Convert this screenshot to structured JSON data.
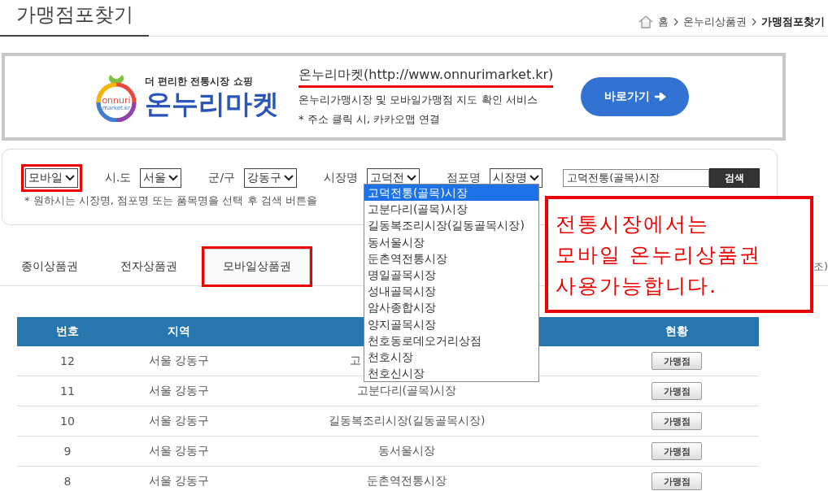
{
  "page_title": "가맹점포찾기",
  "breadcrumb": [
    {
      "label": "홈",
      "current": false
    },
    {
      "label": "온누리상품권",
      "current": false
    },
    {
      "label": "가맹점포찾기",
      "current": true
    }
  ],
  "banner": {
    "logo_ring_text": "onnuri",
    "logo_ring_subtext": "market.kr",
    "tagline": "더 편리한 전통시장 쇼핑",
    "brand": "온누리마켓",
    "link": "온누리마켓(http://www.onnurimarket.kr)",
    "description": "온누리가맹시장 및 모바일가맹점 지도 확인 서비스",
    "note": "* 주소 클릭 시, 카카오맵 연결",
    "button": "바로가기"
  },
  "filters": [
    {
      "kind": "select",
      "value": "모바일",
      "highlighted": true
    },
    {
      "kind": "select",
      "label": "시.도",
      "value": "서울",
      "highlighted": false
    },
    {
      "kind": "select",
      "label": "군/구",
      "value": "강동구",
      "highlighted": false
    },
    {
      "kind": "select",
      "label": "시장명",
      "value": "고덕전",
      "highlighted": false
    },
    {
      "kind": "select",
      "label": "점포명",
      "value": "시장명",
      "highlighted": false
    },
    {
      "kind": "input",
      "value": "고덕전통(골목)시장"
    }
  ],
  "search_button": "검색",
  "hint": "* 원하시는 시장명, 점포명 또는 품목명을 선택 후 검색 버튼을",
  "dropdown_options": [
    {
      "label": "고덕전통(골목)시장",
      "selected": true
    },
    {
      "label": "고분다리(골목)시장",
      "selected": false
    },
    {
      "label": "길동복조리시장(길동골목시장)",
      "selected": false
    },
    {
      "label": "동서울시장",
      "selected": false
    },
    {
      "label": "둔촌역전통시장",
      "selected": false
    },
    {
      "label": "명일골목시장",
      "selected": false
    },
    {
      "label": "성내골목시장",
      "selected": false
    },
    {
      "label": "암사종합시장",
      "selected": false
    },
    {
      "label": "양지골목시장",
      "selected": false
    },
    {
      "label": "천호동로데오거리상점",
      "selected": false
    },
    {
      "label": "천호시장",
      "selected": false
    },
    {
      "label": "천호신시장",
      "selected": false
    }
  ],
  "callout": [
    "전통시장에서는",
    "모바일 온누리상품권",
    "사용가능합니다."
  ],
  "tabs": [
    {
      "label": "종이상품권",
      "selected": false,
      "highlighted": false
    },
    {
      "label": "전자상품권",
      "selected": false,
      "highlighted": false
    },
    {
      "label": "모바일상품권",
      "selected": true,
      "highlighted": true
    }
  ],
  "tabs_side_text": "조)",
  "table": {
    "columns": [
      "번호",
      "지역",
      "",
      "현황"
    ],
    "rows": [
      [
        "12",
        "서울 강동구",
        "고",
        "가맹점"
      ],
      [
        "11",
        "서울 강동구",
        "고분다리(골목)시장",
        "가맹점"
      ],
      [
        "10",
        "서울 강동구",
        "길동복조리시장(길동골목시장)",
        "가맹점"
      ],
      [
        "9",
        "서울 강동구",
        "동서울시장",
        "가맹점"
      ],
      [
        "8",
        "서울 강동구",
        "둔촌역전통시장",
        "가맹점"
      ]
    ]
  }
}
